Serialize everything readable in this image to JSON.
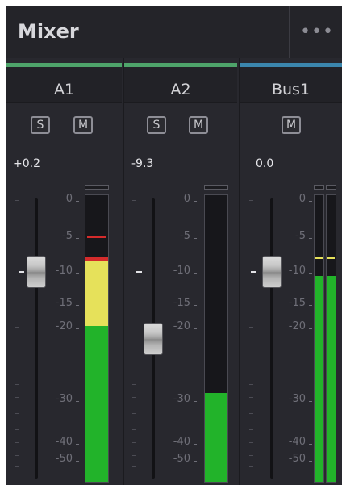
{
  "header": {
    "title": "Mixer",
    "more_label": "•••"
  },
  "scale": [
    "0",
    "-5",
    "-10",
    "-15",
    "-20",
    "-30",
    "-40",
    "-50"
  ],
  "channels": [
    {
      "name": "A1",
      "color": "#4ea46a",
      "solo_label": "S",
      "mute_label": "M",
      "level": "+0.2"
    },
    {
      "name": "A2",
      "color": "#4ea46a",
      "solo_label": "S",
      "mute_label": "M",
      "level": "-9.3"
    },
    {
      "name": "Bus1",
      "color": "#3b86ad",
      "mute_label": "M",
      "level": "0.0"
    }
  ]
}
